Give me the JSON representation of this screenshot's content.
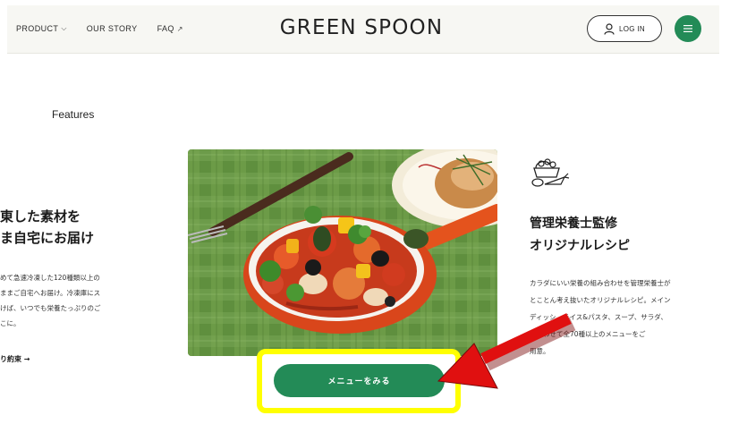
{
  "header": {
    "nav": [
      {
        "label": "PRODUCT",
        "caret": "⌵"
      },
      {
        "label": "OUR STORY"
      },
      {
        "label": "FAQ",
        "caret": "↗"
      }
    ],
    "logo": "GREEN SPOON",
    "login_label": "LOG IN",
    "menu_icon": "hamburger-icon"
  },
  "section": {
    "label": "Features"
  },
  "left_feature": {
    "heading_lines": [
      "東した素材を",
      "ま自宅にお届け"
    ],
    "body_lines": [
      "めて急速冷凍した120種類以上の",
      "ままご自宅へお届け。冷凍庫にス",
      "けば、いつでも栄養たっぷりのご",
      "こに。"
    ],
    "link": "り約束 →"
  },
  "right_feature": {
    "icon": "vegetables-icon",
    "heading_lines": [
      "管理栄養士監修",
      "オリジナルレシピ"
    ],
    "body_lines": [
      "カラダにいい栄養の組み合わせを管理栄養士が",
      "とことん考え抜いたオリジナルレシピ。メイン",
      "ディッシ　ライス&パスタ、スープ、サラダ、",
      "　　わせて全70種以上のメニューをご",
      "用意。"
    ]
  },
  "cta": {
    "label": "メニューをみる"
  },
  "colors": {
    "brand_green": "#238b57",
    "highlight": "#ffff00",
    "arrow": "#e01010"
  }
}
